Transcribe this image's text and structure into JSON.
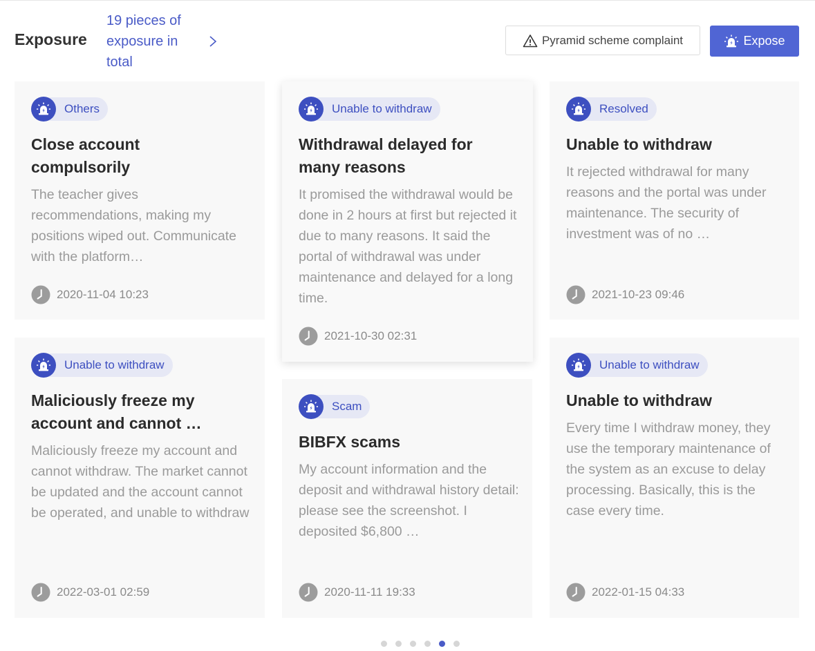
{
  "header": {
    "title": "Exposure",
    "count_text": "19 pieces of exposure in total",
    "complaint_button": "Pyramid scheme complaint",
    "expose_button": "Expose"
  },
  "colors": {
    "accent": "#5065d4",
    "tag_icon": "#3d4fc0",
    "tag_bg": "#e6e8f5",
    "active_dot": "#4a5bc7"
  },
  "cards": [
    {
      "tag": "Others",
      "title": "Close account compulsorily",
      "body": "The teacher gives recommendations, making my positions wiped out. Communicate with the platform…",
      "time": "2020-11-04 10:23"
    },
    {
      "tag": "Unable to withdraw",
      "title": "Withdrawal delayed for many reasons",
      "body": "It promised the withdrawal would be done in 2 hours at first but rejected it due to many reasons. It said the portal of withdrawal was under maintenance and delayed for a long time.",
      "time": "2021-10-30 02:31"
    },
    {
      "tag": "Resolved",
      "title": "Unable to withdraw",
      "body": "It rejected withdrawal for many reasons and the portal was under maintenance. The security of investment was of no …",
      "time": "2021-10-23 09:46"
    },
    {
      "tag": "Unable to withdraw",
      "title": "Maliciously freeze my account and cannot …",
      "body": "Maliciously freeze my account and cannot withdraw. The market cannot be updated and the account cannot be operated, and unable to withdraw",
      "time": "2022-03-01 02:59"
    },
    {
      "tag": "Scam",
      "title": "BIBFX scams",
      "body": "My account information and the deposit and withdrawal history detail: please see the screenshot. I deposited $6,800 …",
      "time": "2020-11-11 19:33"
    },
    {
      "tag": "Unable to withdraw",
      "title": "Unable to withdraw",
      "body": "Every time I withdraw money, they use the temporary maintenance of the system as an excuse to delay processing. Basically, this is the case every time.",
      "time": "2022-01-15 04:33"
    }
  ],
  "pagination": {
    "total": 6,
    "active_index": 4
  }
}
